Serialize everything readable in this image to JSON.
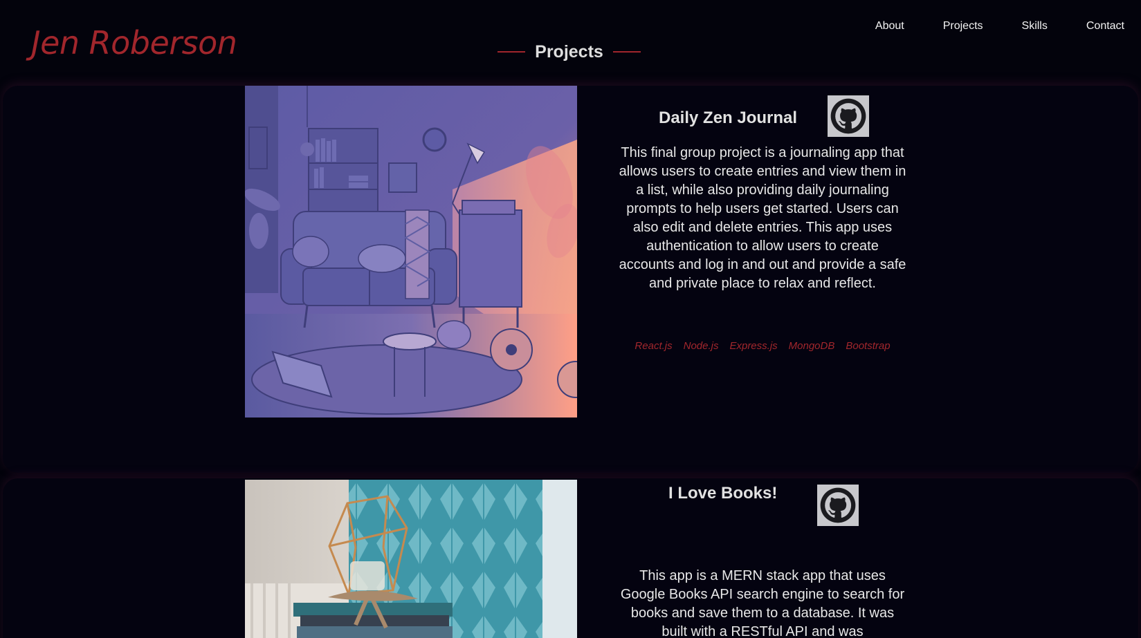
{
  "header": {
    "brand": "Jen Roberson"
  },
  "nav": {
    "items": [
      {
        "label": "About"
      },
      {
        "label": "Projects"
      },
      {
        "label": "Skills"
      },
      {
        "label": "Contact"
      }
    ]
  },
  "section": {
    "title": "Projects"
  },
  "projects": [
    {
      "title": "Daily Zen Journal",
      "description": "This final group project is a journaling app that allows users to create entries and view them in a list, while also providing daily journaling prompts to help users get started. Users can also edit and delete entries. This app uses authentication to allow users to create accounts and log in and out and provide a safe and private place to relax and reflect.",
      "tech": [
        "React.js",
        "Node.js",
        "Express.js",
        "MongoDB",
        "Bootstrap"
      ],
      "image_icon": "cozy-living-room-illustration",
      "link_icon": "github-icon"
    },
    {
      "title": "I Love Books!",
      "description": "This app is a MERN stack app that uses Google Books API search engine to search for books and save them to a database. It was built with a RESTful API and was",
      "image_icon": "books-and-candle-photo",
      "link_icon": "github-icon"
    }
  ],
  "colors": {
    "background": "#03030c",
    "accent": "#a1262c",
    "text": "#e8e8e8",
    "github_tile": "#c8c8cc"
  }
}
